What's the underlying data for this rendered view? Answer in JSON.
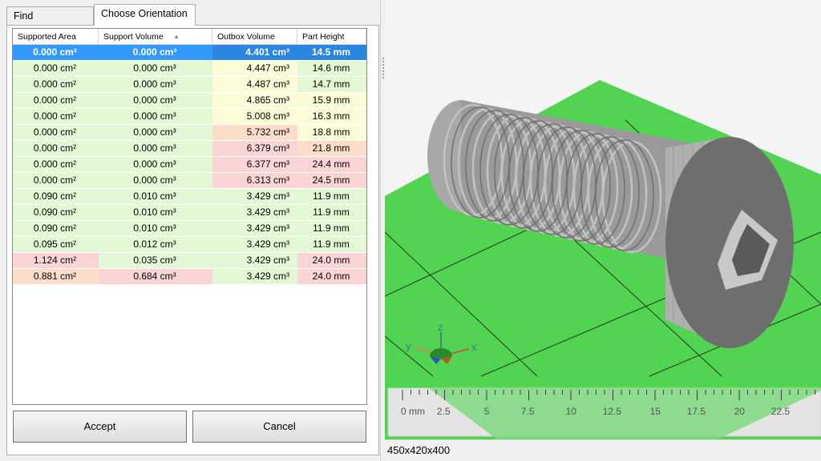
{
  "tabs": {
    "find_label": "Find Orientations",
    "choose_label": "Choose Orientation"
  },
  "table": {
    "headers": [
      "Supported Area",
      "Support Volume",
      "Outbox Volume",
      "Part Height"
    ],
    "sort_column": "Support Volume",
    "rows": [
      [
        "0.000 cm²",
        "0.000 cm³",
        "4.401 cm³",
        "14.5 mm"
      ],
      [
        "0.000 cm²",
        "0.000 cm³",
        "4.447 cm³",
        "14.6 mm"
      ],
      [
        "0.000 cm²",
        "0.000 cm³",
        "4.487 cm³",
        "14.7 mm"
      ],
      [
        "0.000 cm²",
        "0.000 cm³",
        "4.865 cm³",
        "15.9 mm"
      ],
      [
        "0.000 cm²",
        "0.000 cm³",
        "5.008 cm³",
        "16.3 mm"
      ],
      [
        "0.000 cm²",
        "0.000 cm³",
        "5.732 cm³",
        "18.8 mm"
      ],
      [
        "0.000 cm²",
        "0.000 cm³",
        "6.379 cm³",
        "21.8 mm"
      ],
      [
        "0.000 cm²",
        "0.000 cm³",
        "6.377 cm³",
        "24.4 mm"
      ],
      [
        "0.000 cm²",
        "0.000 cm³",
        "6.313 cm³",
        "24.5 mm"
      ],
      [
        "0.090 cm²",
        "0.010 cm³",
        "3.429 cm³",
        "11.9 mm"
      ],
      [
        "0.090 cm²",
        "0.010 cm³",
        "3.429 cm³",
        "11.9 mm"
      ],
      [
        "0.090 cm²",
        "0.010 cm³",
        "3.429 cm³",
        "11.9 mm"
      ],
      [
        "0.095 cm²",
        "0.012 cm³",
        "3.429 cm³",
        "11.9 mm"
      ],
      [
        "1.124 cm²",
        "0.035 cm³",
        "3.429 cm³",
        "24.0 mm"
      ],
      [
        "0.881 cm²",
        "0.684 cm³",
        "3.429 cm³",
        "24.0 mm"
      ]
    ],
    "row_colors": [
      [
        "sel",
        "sel",
        "sel",
        "sel"
      ],
      [
        "g",
        "g",
        "y",
        "g"
      ],
      [
        "g",
        "g",
        "y",
        "g"
      ],
      [
        "g",
        "g",
        "y",
        "y"
      ],
      [
        "g",
        "g",
        "y",
        "y"
      ],
      [
        "g",
        "g",
        "o",
        "y"
      ],
      [
        "g",
        "g",
        "r",
        "o"
      ],
      [
        "g",
        "g",
        "r",
        "r"
      ],
      [
        "g",
        "g",
        "r",
        "r"
      ],
      [
        "g",
        "g",
        "g",
        "g"
      ],
      [
        "g",
        "g",
        "g",
        "g"
      ],
      [
        "g",
        "g",
        "g",
        "g"
      ],
      [
        "g",
        "g",
        "g",
        "g"
      ],
      [
        "r",
        "g",
        "g",
        "r"
      ],
      [
        "o",
        "r",
        "g",
        "r"
      ]
    ],
    "selected_row": 0
  },
  "buttons": {
    "accept_label": "Accept",
    "cancel_label": "Cancel"
  },
  "viewport": {
    "axis_x": "x",
    "axis_y": "y",
    "axis_z": "z",
    "ruler_unit_label": "0 mm",
    "ruler_ticks": [
      "2.5",
      "5",
      "7.5",
      "10",
      "12.5",
      "15",
      "17.5",
      "20",
      "22.5"
    ],
    "platform_color": "#4fd44f",
    "part_color": "#8a8a8a"
  },
  "status": {
    "dimensions": "450x420x400"
  }
}
